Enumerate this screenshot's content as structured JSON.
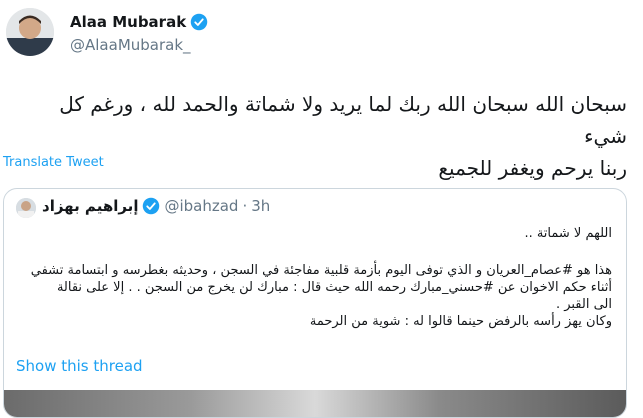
{
  "author": {
    "name": "Alaa Mubarak",
    "handle": "@AlaaMubarak_",
    "verified_color": "#1da1f2"
  },
  "tweet": {
    "lines": [
      "سبحان الله سبحان الله ربك لما يريد ولا شماتة والحمد لله ، ورغم كل شيء",
      "ربنا يرحم ويغفر للجميع"
    ],
    "translate_label": "Translate Tweet"
  },
  "quoted": {
    "name": "إبراهيم بهزاد",
    "handle": "@ibahzad",
    "separator": "·",
    "time": "3h",
    "lines": [
      "اللهم لا شماتة ..",
      "هذا هو #عصام_العريان و الذي توفى اليوم بأزمة قلبية مفاجئة في السجن ، وحديثه بغطرسه و ابتسامة تشفي",
      "أثناء حكم الاخوان عن #حسني_مبارك رحمه الله حيث قال : مبارك لن يخرج من السجن . . إلا على نقالة",
      "الى القبر .",
      "وكان يهز رأسه بالرفض حينما قالوا له : شوية من الرحمة"
    ],
    "show_thread_label": "Show this thread"
  },
  "colors": {
    "link": "#1da1f2",
    "muted": "#657786",
    "border": "#ccd6dd"
  }
}
